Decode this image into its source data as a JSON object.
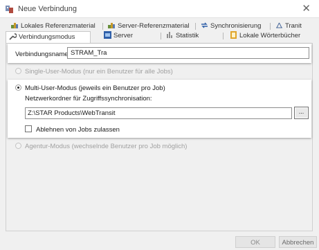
{
  "window": {
    "title": "Neue Verbindung",
    "close_glyph": "✕"
  },
  "tabs": {
    "row1": [
      {
        "label": "Lokales Referenzmaterial",
        "icon": "reference-icon"
      },
      {
        "label": "Server-Referenzmaterial",
        "icon": "reference-icon"
      },
      {
        "label": "Synchronisierung",
        "icon": "sync-icon"
      },
      {
        "label": "Tranit",
        "icon": "transit-icon"
      }
    ],
    "row2": [
      {
        "label": "Verbindungsmodus",
        "icon": "wrench-icon",
        "active": true
      },
      {
        "label": "Server",
        "icon": "server-icon"
      },
      {
        "label": "Statistik",
        "icon": "statistics-icon"
      },
      {
        "label": "Lokale Wörterbücher",
        "icon": "dictionary-icon"
      }
    ]
  },
  "connection": {
    "label": "Verbindungsname:",
    "value": "STRAM_Tra"
  },
  "modes": {
    "single": {
      "label": "Single-User-Modus (nur ein Benutzer für alle Jobs)",
      "checked": false,
      "enabled": false
    },
    "multi": {
      "label": "Multi-User-Modus (jeweils ein Benutzer pro Job)",
      "checked": true,
      "enabled": true
    },
    "agent": {
      "label": "Agentur-Modus (wechselnde Benutzer pro Job möglich)",
      "checked": false,
      "enabled": false
    }
  },
  "multi": {
    "folder_label": "Netzwerkordner für Zugriffssynchronisation:",
    "folder_value": "Z:\\STAR Products\\WebTransit",
    "browse_label": "...",
    "reject_label": "Ablehnen von Jobs zulassen",
    "reject_checked": false
  },
  "footer": {
    "ok_label": "OK",
    "cancel_label": "Abbrechen"
  }
}
